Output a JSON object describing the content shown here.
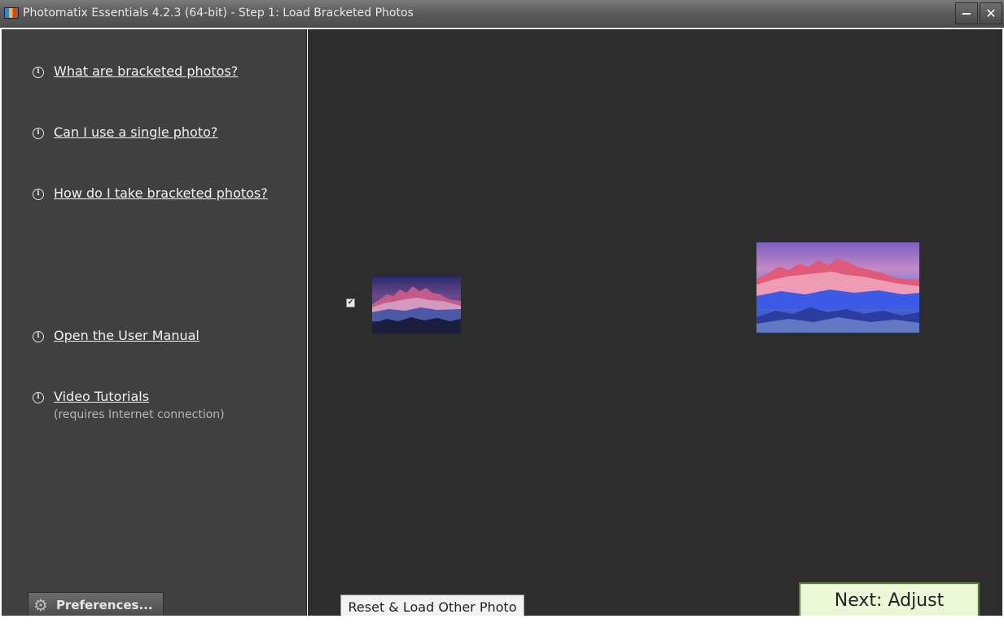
{
  "window": {
    "title": "Photomatix Essentials  4.2.3 (64-bit) - Step 1: Load Bracketed Photos",
    "minimize_label": "−",
    "close_label": "✕"
  },
  "sidebar": {
    "links": [
      {
        "label": "What are bracketed photos?"
      },
      {
        "label": "Can I use a single photo?"
      },
      {
        "label": "How do I take bracketed photos?"
      },
      {
        "label": "Open the User Manual"
      },
      {
        "label": "Video Tutorials"
      }
    ],
    "video_note": "(requires Internet connection)",
    "info_icon_glyph": "i",
    "preferences_label": "Preferences...",
    "gear_glyph": "⚙"
  },
  "main": {
    "thumbnail_checked": true,
    "checkbox_glyph": "✔",
    "reset_label": "Reset & Load Other Photo",
    "next_label": "Next: Adjust"
  },
  "colors": {
    "sidebar_bg": "#404040",
    "main_bg": "#2d2d2d",
    "next_button_bg": "#eaf8d8"
  }
}
